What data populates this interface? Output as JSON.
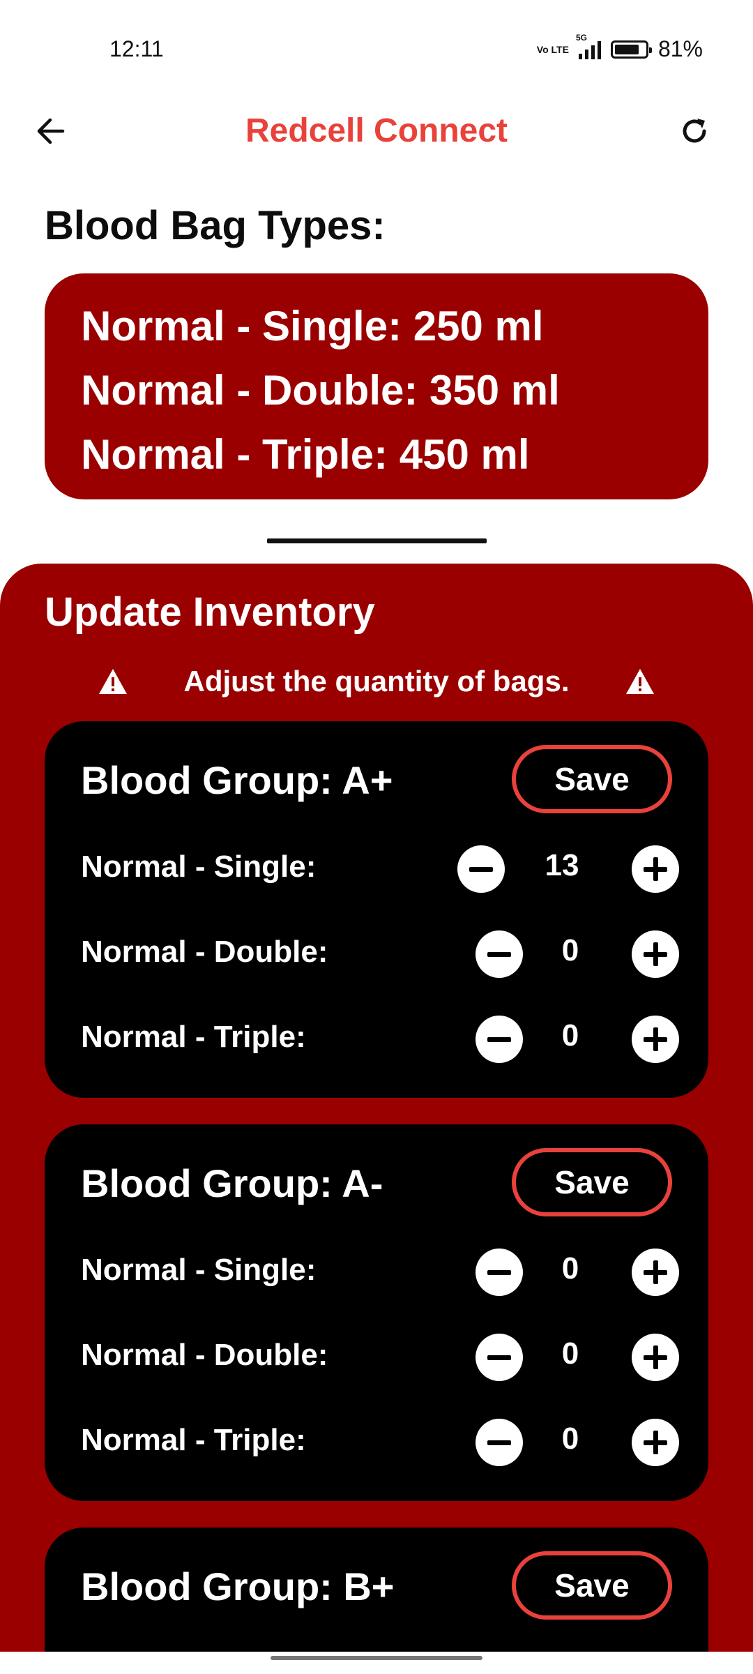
{
  "status_bar": {
    "time": "12:11",
    "network_volte": "Vo LTE",
    "network_type": "5G",
    "battery_percent": "81%"
  },
  "header": {
    "title": "Redcell Connect",
    "back_icon": "arrow-left-icon",
    "refresh_icon": "refresh-icon"
  },
  "bag_types": {
    "title": "Blood Bag Types:",
    "lines": [
      "Normal - Single: 250 ml",
      "Normal - Double: 350 ml",
      "Normal - Triple: 450 ml"
    ]
  },
  "inventory": {
    "title": "Update Inventory",
    "note": "Adjust the quantity of bags.",
    "note_icon": "warning-icon",
    "save_label": "Save",
    "groups": [
      {
        "title": "Blood Group: A+",
        "rows": [
          {
            "label": "Normal - Single:",
            "qty": "13"
          },
          {
            "label": "Normal - Double:",
            "qty": "0"
          },
          {
            "label": "Normal - Triple:",
            "qty": "0"
          }
        ]
      },
      {
        "title": "Blood Group: A-",
        "rows": [
          {
            "label": "Normal - Single:",
            "qty": "0"
          },
          {
            "label": "Normal - Double:",
            "qty": "0"
          },
          {
            "label": "Normal - Triple:",
            "qty": "0"
          }
        ]
      },
      {
        "title": "Blood Group: B+",
        "rows": []
      }
    ]
  },
  "colors": {
    "brand_red": "#e8423a",
    "panel_red": "#9b0000",
    "card_black": "#000000"
  }
}
